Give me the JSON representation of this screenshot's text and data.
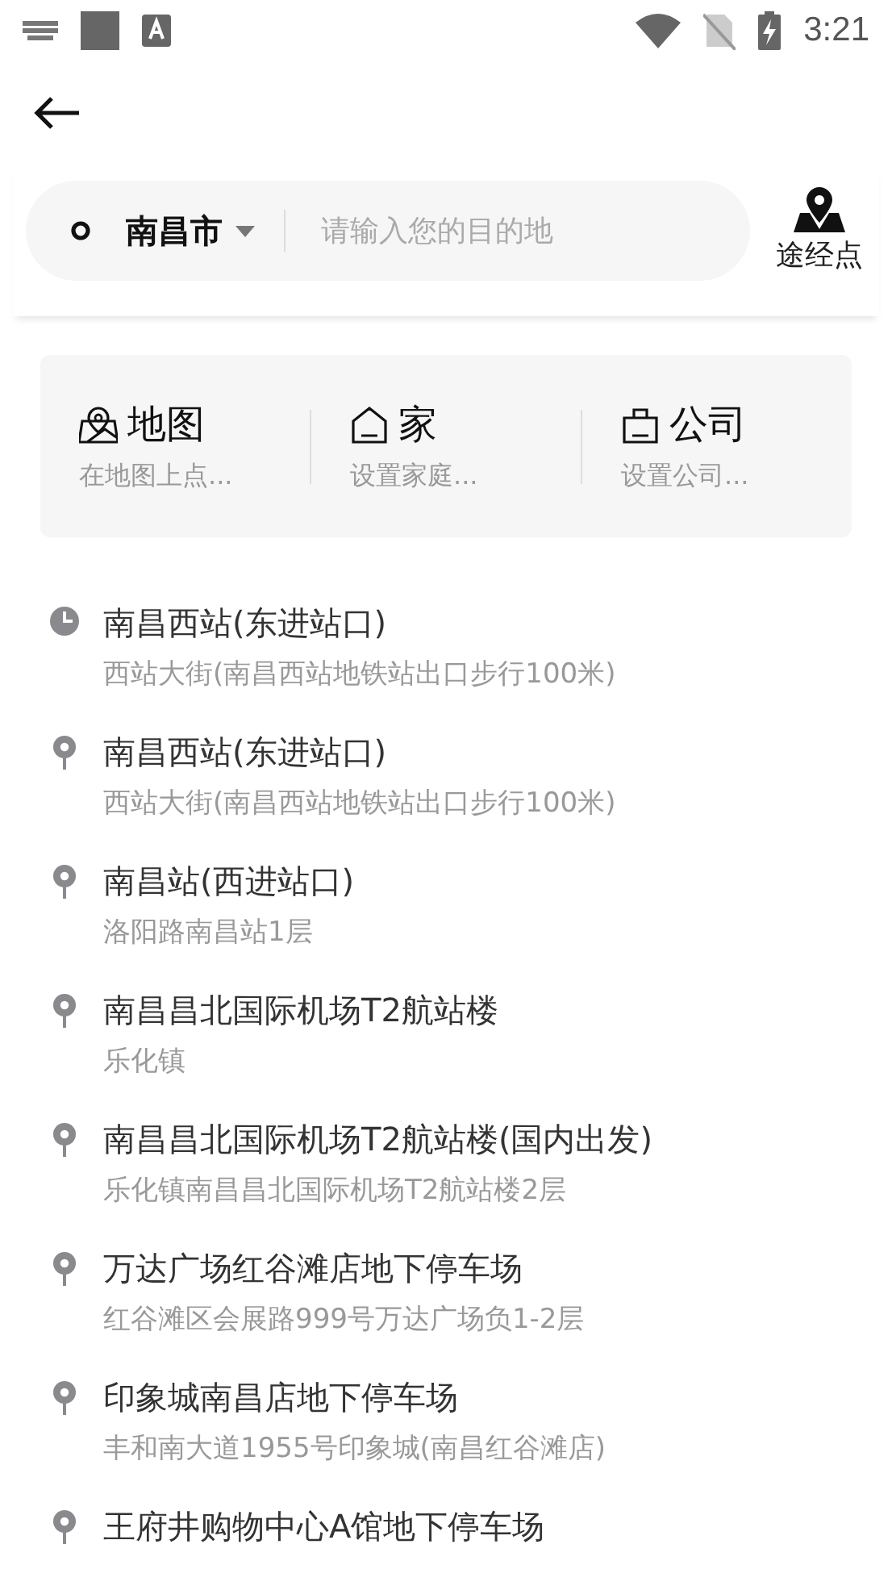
{
  "status_bar": {
    "time": "3:21"
  },
  "search": {
    "city": "南昌市",
    "placeholder": "请输入您的目的地"
  },
  "waypoint_button": {
    "label": "途经点"
  },
  "shortcuts": [
    {
      "kind": "map",
      "title": "地图",
      "subtitle": "在地图上点..."
    },
    {
      "kind": "home",
      "title": "家",
      "subtitle": "设置家庭..."
    },
    {
      "kind": "company",
      "title": "公司",
      "subtitle": "设置公司..."
    }
  ],
  "places": [
    {
      "kind": "history",
      "name": "南昌西站(东进站口)",
      "address": "西站大街(南昌西站地铁站出口步行100米)"
    },
    {
      "kind": "place",
      "name": "南昌西站(东进站口)",
      "address": "西站大街(南昌西站地铁站出口步行100米)"
    },
    {
      "kind": "place",
      "name": "南昌站(西进站口)",
      "address": "洛阳路南昌站1层"
    },
    {
      "kind": "place",
      "name": "南昌昌北国际机场T2航站楼",
      "address": "乐化镇"
    },
    {
      "kind": "place",
      "name": "南昌昌北国际机场T2航站楼(国内出发)",
      "address": "乐化镇南昌昌北国际机场T2航站楼2层"
    },
    {
      "kind": "place",
      "name": "万达广场红谷滩店地下停车场",
      "address": "红谷滩区会展路999号万达广场负1-2层"
    },
    {
      "kind": "place",
      "name": "印象城南昌店地下停车场",
      "address": "丰和南大道1955号印象城(南昌红谷滩店)"
    },
    {
      "kind": "place",
      "name": "王府井购物中心A馆地下停车场"
    }
  ]
}
